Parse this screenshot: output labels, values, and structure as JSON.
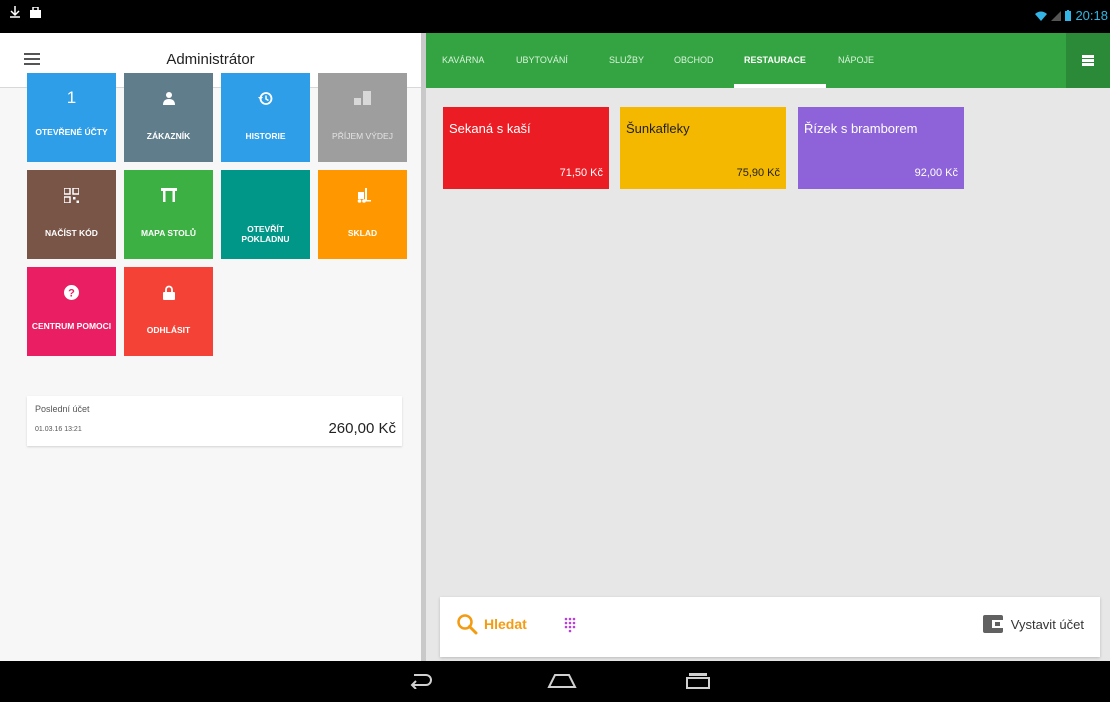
{
  "status_bar": {
    "time": "20:18"
  },
  "left_panel": {
    "title": "Administrátor",
    "tiles": [
      {
        "label": "OTEVŘENÉ ÚČTY",
        "icon": "one-icon",
        "color": "#2f9ee8"
      },
      {
        "label": "ZÁKAZNÍK",
        "icon": "person-icon",
        "color": "#607d8b"
      },
      {
        "label": "HISTORIE",
        "icon": "history-icon",
        "color": "#2f9ee8"
      },
      {
        "label": "PŘÍJEM VÝDEJ",
        "icon": "stock-icon",
        "color": "#9e9e9e"
      },
      {
        "label": "NAČÍST KÓD",
        "icon": "qr-code-icon",
        "color": "#795548"
      },
      {
        "label": "MAPA STOLŮ",
        "icon": "table-icon",
        "color": "#3cb043"
      },
      {
        "label": "OTEVŘÍT POKLADNU",
        "icon": "",
        "color": "#009688"
      },
      {
        "label": "SKLAD",
        "icon": "forklift-icon",
        "color": "#ff9800"
      },
      {
        "label": "CENTRUM POMOCI",
        "icon": "help-icon",
        "color": "#e91e63"
      },
      {
        "label": "ODHLÁSIT",
        "icon": "lock-icon",
        "color": "#f44336"
      }
    ],
    "last_bill": {
      "label": "Poslední účet",
      "date": "01.03.16 13:21",
      "amount": "260,00 Kč"
    }
  },
  "right_panel": {
    "tabs": [
      "KAVÁRNA",
      "UBYTOVÁNÍ",
      "SLUŽBY",
      "OBCHOD",
      "RESTAURACE",
      "NÁPOJE"
    ],
    "active_tab": "RESTAURACE",
    "products": [
      {
        "name": "Sekaná s kaší",
        "price": "71,50 Kč",
        "color": "#ec1c24"
      },
      {
        "name": "Šunkafleky",
        "price": "75,90 Kč",
        "color": "#f4b800"
      },
      {
        "name": "Řízek s bramborem",
        "price": "92,00 Kč",
        "color": "#8e63d9"
      }
    ],
    "search_label": "Hledat",
    "issue_bill_label": "Vystavit účet"
  },
  "colors": {
    "accent_green": "#34a442",
    "search_orange": "#f39c12",
    "keypad_purple": "#b83fd9"
  }
}
